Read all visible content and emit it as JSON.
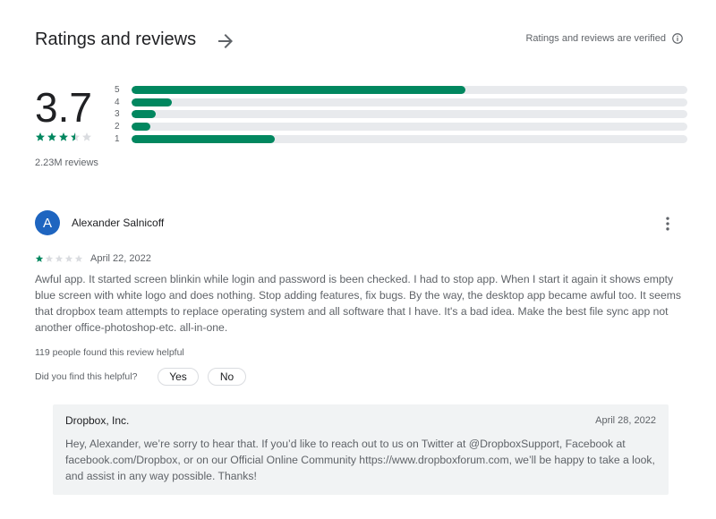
{
  "header": {
    "title": "Ratings and reviews",
    "verified_text": "Ratings and reviews are verified"
  },
  "summary": {
    "score": "3.7",
    "stars": 3.5,
    "total_reviews": "2.23M reviews",
    "distribution": [
      {
        "label": "5",
        "fraction": 0.6
      },
      {
        "label": "4",
        "fraction": 0.072
      },
      {
        "label": "3",
        "fraction": 0.043
      },
      {
        "label": "2",
        "fraction": 0.034
      },
      {
        "label": "1",
        "fraction": 0.258
      }
    ]
  },
  "colors": {
    "accent_green": "#01875f",
    "star_empty": "#dadce0",
    "avatar_bg": "#1e65c0"
  },
  "review": {
    "avatar_letter": "A",
    "author": "Alexander Salnicoff",
    "stars": 1,
    "date": "April 22, 2022",
    "text": "Awful app. It started screen blinkin while login and password is been checked. I had to stop app. When I start it again it shows empty blue screen with white logo and does nothing. Stop adding features, fix bugs. By the way, the desktop app became awful too. It seems that dropbox team attempts to replace operating system and all software that I have. It's a bad idea. Make the best file sync app not another office-photoshop-etc. all-in-one.",
    "helpful_count": "119 people found this review helpful",
    "helpful_question": "Did you find this helpful?",
    "yes_label": "Yes",
    "no_label": "No"
  },
  "reply": {
    "developer": "Dropbox, Inc.",
    "date": "April 28, 2022",
    "text": "Hey, Alexander, we’re sorry to hear that. If you’d like to reach out to us on Twitter at @DropboxSupport, Facebook at facebook.com/Dropbox, or on our Official Online Community https://www.dropboxforum.com, we’ll be happy to take a look, and assist in any way possible. Thanks!"
  },
  "icons": {
    "header_arrow": "arrow-right-icon",
    "verified_info": "info-icon",
    "review_menu": "more-vert-icon",
    "star": "star-icon"
  }
}
